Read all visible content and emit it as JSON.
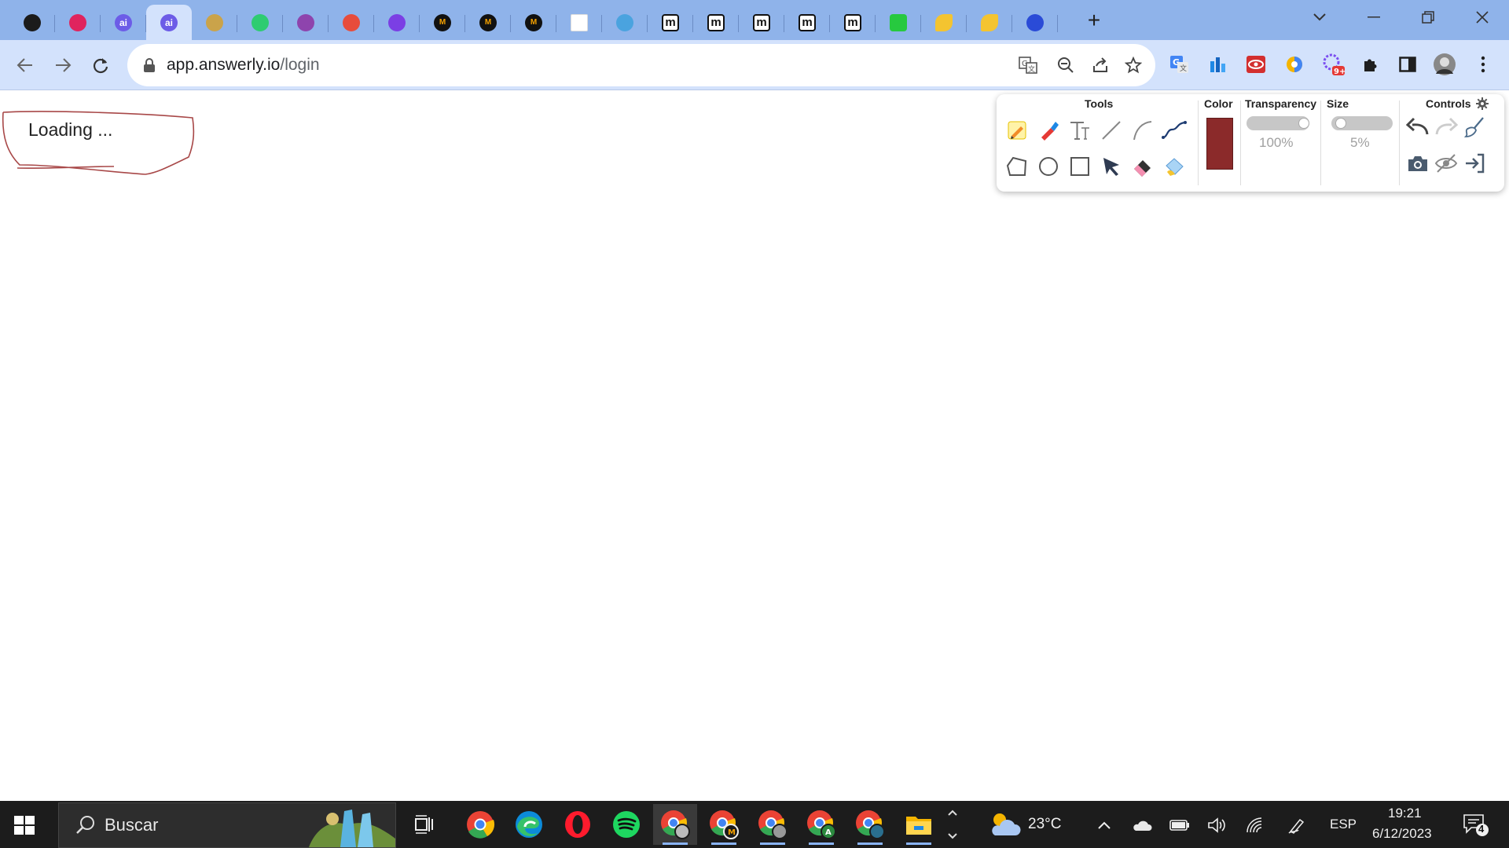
{
  "browser": {
    "tabs": [
      {
        "icon": "cursor-icon",
        "color": "#1b1b1b"
      },
      {
        "icon": "rec-icon",
        "color": "#e0245e"
      },
      {
        "icon": "answerly-icon",
        "color": "#6c5ce7",
        "letter": "ai"
      },
      {
        "icon": "answerly-icon",
        "color": "#6c5ce7",
        "letter": "ai",
        "active": true
      },
      {
        "icon": "magic-wand-icon",
        "color": "#caa34a"
      },
      {
        "icon": "green-shield-icon",
        "color": "#2ecc71"
      },
      {
        "icon": "lightning-icon",
        "color": "#8e44ad"
      },
      {
        "icon": "colorful-icon",
        "color": "#e74c3c"
      },
      {
        "icon": "triangle-icon",
        "color": "#7b3fe4"
      },
      {
        "icon": "m-circle-icon",
        "color": "#111111",
        "letter": "M"
      },
      {
        "icon": "m-circle-icon",
        "color": "#111111",
        "letter": "M"
      },
      {
        "icon": "m-circle-icon",
        "color": "#111111",
        "letter": "M"
      },
      {
        "icon": "blank-page-icon",
        "color": "#ffffff"
      },
      {
        "icon": "cloud-icon",
        "color": "#4aa3df"
      },
      {
        "icon": "miro-icon",
        "color": "#111111",
        "letter": "m"
      },
      {
        "icon": "miro-icon",
        "color": "#111111",
        "letter": "m"
      },
      {
        "icon": "miro-icon",
        "color": "#111111",
        "letter": "m"
      },
      {
        "icon": "miro-icon",
        "color": "#111111",
        "letter": "m"
      },
      {
        "icon": "miro-icon",
        "color": "#111111",
        "letter": "m"
      },
      {
        "icon": "green-square-icon",
        "color": "#27c93f"
      },
      {
        "icon": "yellow-leaf-icon",
        "color": "#f4c430"
      },
      {
        "icon": "yellow-leaf-icon",
        "color": "#f4c430"
      },
      {
        "icon": "blue-circle-icon",
        "color": "#2a4bd7"
      }
    ],
    "url_host": "app.answerly.io",
    "url_path": "/login"
  },
  "page": {
    "loading_text": "Loading ..."
  },
  "drawing_panel": {
    "tools_title": "Tools",
    "color_title": "Color",
    "transparency_title": "Transparency",
    "size_title": "Size",
    "controls_title": "Controls",
    "selected_color": "#8b2a2a",
    "transparency_value": "100%",
    "size_value": "5%",
    "transparency_fraction": 1.0,
    "size_fraction": 0.05
  },
  "taskbar": {
    "search_placeholder": "Buscar",
    "temperature": "23°C",
    "language": "ESP",
    "time": "19:21",
    "date": "6/12/2023",
    "notification_count": "4"
  }
}
